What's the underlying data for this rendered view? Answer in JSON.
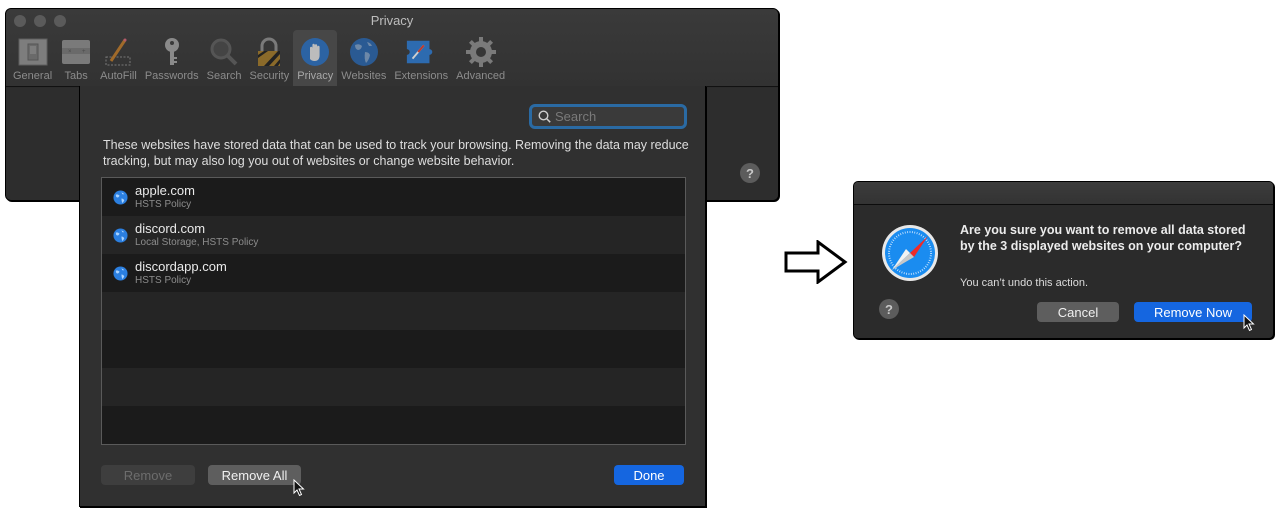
{
  "prefs_window": {
    "title": "Privacy",
    "tabs": [
      {
        "label": "General",
        "icon": "general-switch-icon",
        "active": false
      },
      {
        "label": "Tabs",
        "icon": "tabs-icon",
        "active": false
      },
      {
        "label": "AutoFill",
        "icon": "autofill-pencil-icon",
        "active": false
      },
      {
        "label": "Passwords",
        "icon": "key-icon",
        "active": false
      },
      {
        "label": "Search",
        "icon": "magnifier-icon",
        "active": false
      },
      {
        "label": "Security",
        "icon": "padlock-icon",
        "active": false
      },
      {
        "label": "Privacy",
        "icon": "hand-icon",
        "active": true
      },
      {
        "label": "Websites",
        "icon": "globe-icon",
        "active": false
      },
      {
        "label": "Extensions",
        "icon": "puzzle-compass-icon",
        "active": false
      },
      {
        "label": "Advanced",
        "icon": "gear-icon",
        "active": false
      }
    ],
    "help_label": "?"
  },
  "sheet": {
    "search": {
      "placeholder": "Search",
      "value": ""
    },
    "description": "These websites have stored data that can be used to track your browsing. Removing the data may reduce tracking, but may also log you out of websites or change website behavior.",
    "sites": [
      {
        "name": "apple.com",
        "detail": "HSTS Policy"
      },
      {
        "name": "discord.com",
        "detail": "Local Storage, HSTS Policy"
      },
      {
        "name": "discordapp.com",
        "detail": "HSTS Policy"
      }
    ],
    "empty_rows": 4,
    "buttons": {
      "remove": "Remove",
      "remove_all": "Remove All",
      "done": "Done"
    }
  },
  "dialog": {
    "message": "Are you sure you want to remove all data stored by the 3 displayed websites on your computer?",
    "informative": "You can’t undo this action.",
    "help_label": "?",
    "buttons": {
      "cancel": "Cancel",
      "remove_now": "Remove Now"
    }
  },
  "colors": {
    "accent_blue": "#1566e0",
    "search_focus_ring": "#2a6aa3"
  }
}
